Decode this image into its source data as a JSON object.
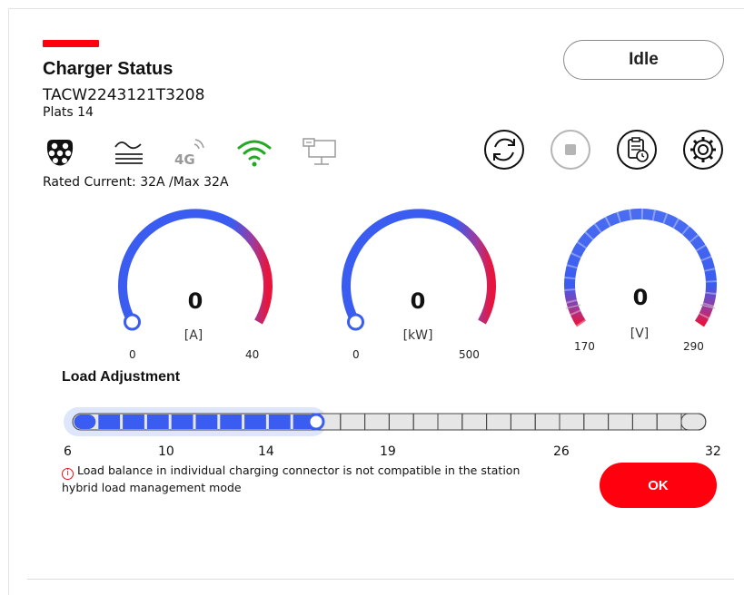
{
  "header": {
    "title": "Charger Status",
    "serial": "TACW2243121T3208",
    "location": "Plats 14",
    "status": "Idle"
  },
  "info_icons": [
    "connector-type2-icon",
    "ac-power-icon",
    "4g-icon",
    "wifi-icon",
    "ethernet-icon"
  ],
  "action_icons": [
    "refresh-icon",
    "stop-icon",
    "schedule-icon",
    "settings-icon"
  ],
  "rated_current": "Rated Current: 32A /Max 32A",
  "gauges": [
    {
      "value": "0",
      "unit": "[A]",
      "min": "0",
      "max": "40"
    },
    {
      "value": "0",
      "unit": "[kW]",
      "min": "0",
      "max": "500"
    },
    {
      "value": "0",
      "unit": "[V]",
      "min": "170",
      "max": "290"
    }
  ],
  "load": {
    "title": "Load Adjustment",
    "ticks": [
      "6",
      "10",
      "14",
      "19",
      "26",
      "32"
    ],
    "min": 6,
    "max": 32,
    "value": 16,
    "warning": "Load balance in individual charging connector is not compatible in the station hybrid load management mode",
    "ok_label": "OK"
  },
  "colors": {
    "brand_red": "#ff000f",
    "gauge_blue": "#3a5cf0",
    "wifi_green": "#22aa22",
    "icon_grey": "#9a9a9a"
  }
}
